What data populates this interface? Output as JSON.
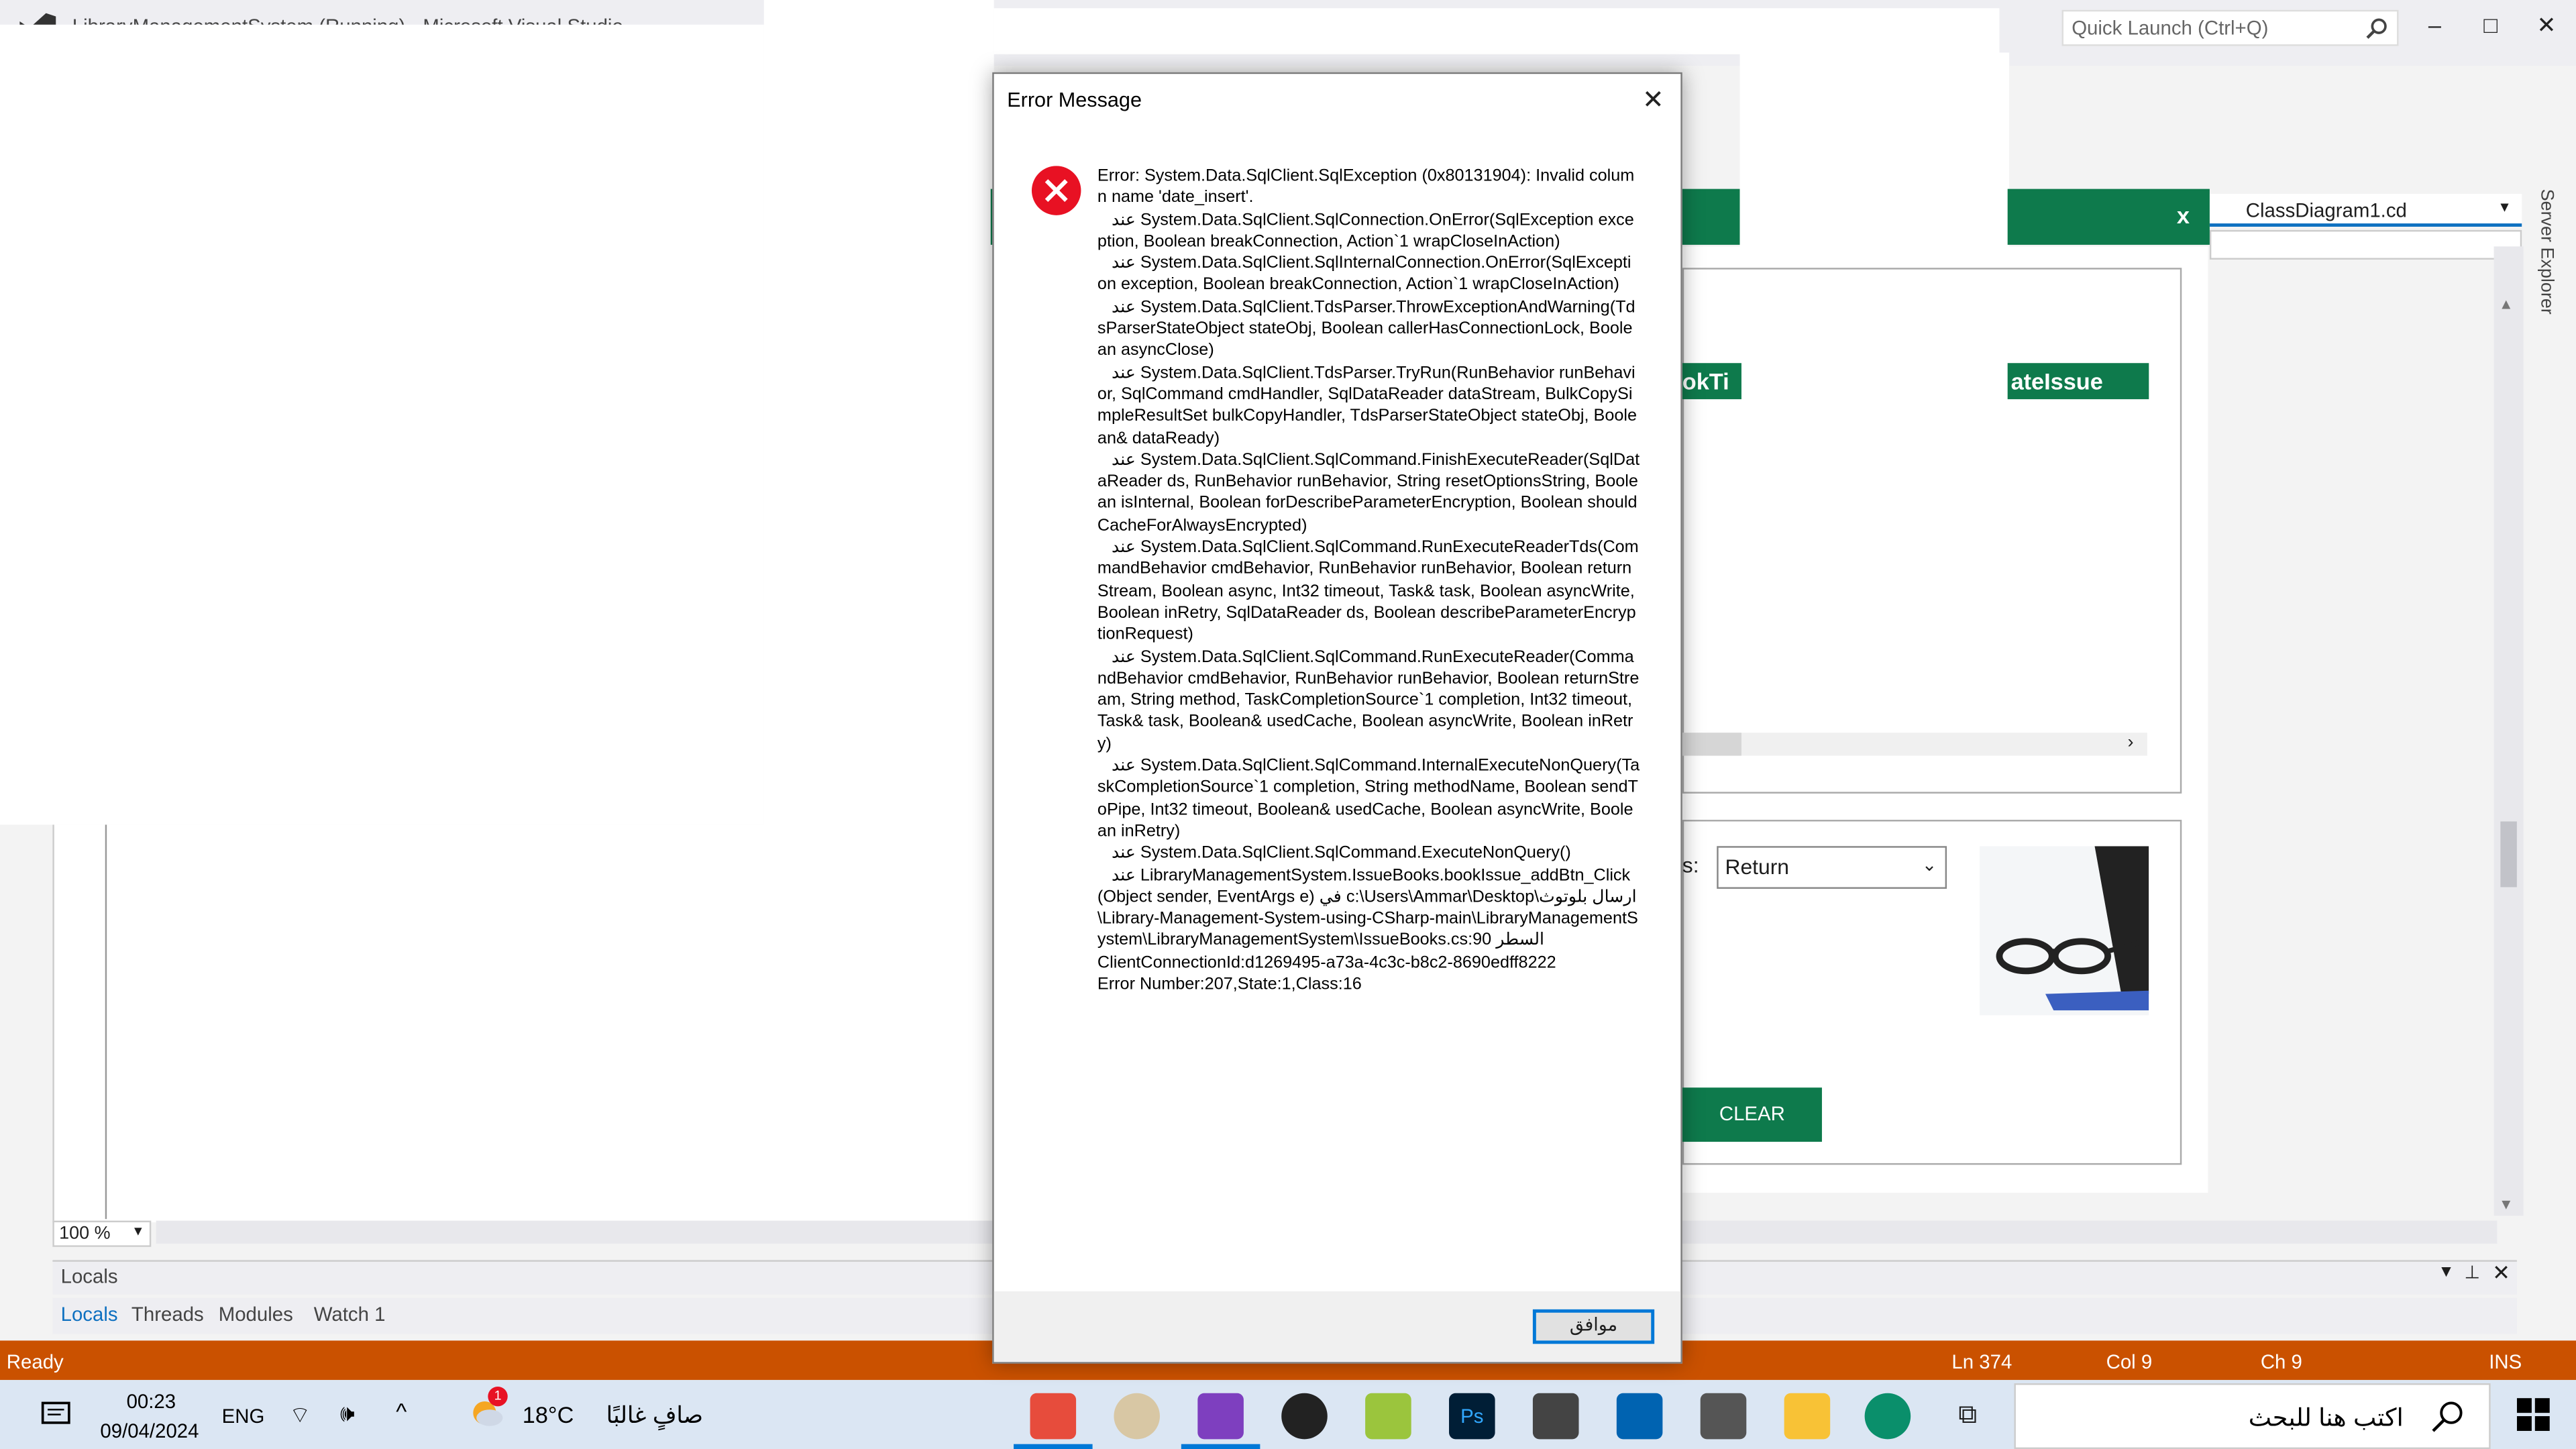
{
  "vs": {
    "title": "LibraryManagementSystem (Running) - Microsoft Visual Studio",
    "quick_launch_placeholder": "Quick Launch (Ctrl+Q)",
    "minimize": "–",
    "maximize": "□",
    "close": "✕",
    "class_diagram_tab": "ClassDiagram1.cd",
    "server_explorer": "Server Explorer",
    "zoom": "100 %",
    "locals_title": "Locals",
    "bottom_tabs": [
      "Locals",
      "Threads",
      "Modules",
      "Watch 1"
    ],
    "status": {
      "ready": "Ready",
      "ln": "Ln 374",
      "col": "Col 9",
      "ch": "Ch 9",
      "ins": "INS"
    }
  },
  "form": {
    "close_label": "x",
    "grid_header_left": "okTi",
    "grid_header_right": "ateIssue",
    "status_label": "s:",
    "status_value": "Return",
    "clear_button": "CLEAR"
  },
  "dialog": {
    "title": "Error Message",
    "message": "Error: System.Data.SqlClient.SqlException (0x80131904): Invalid column name 'date_insert'.\n   عند System.Data.SqlClient.SqlConnection.OnError(SqlException exception, Boolean breakConnection, Action`1 wrapCloseInAction)\n   عند System.Data.SqlClient.SqlInternalConnection.OnError(SqlException exception, Boolean breakConnection, Action`1 wrapCloseInAction)\n   عند System.Data.SqlClient.TdsParser.ThrowExceptionAndWarning(TdsParserStateObject stateObj, Boolean callerHasConnectionLock, Boolean asyncClose)\n   عند System.Data.SqlClient.TdsParser.TryRun(RunBehavior runBehavior, SqlCommand cmdHandler, SqlDataReader dataStream, BulkCopySimpleResultSet bulkCopyHandler, TdsParserStateObject stateObj, Boolean& dataReady)\n   عند System.Data.SqlClient.SqlCommand.FinishExecuteReader(SqlDataReader ds, RunBehavior runBehavior, String resetOptionsString, Boolean isInternal, Boolean forDescribeParameterEncryption, Boolean shouldCacheForAlwaysEncrypted)\n   عند System.Data.SqlClient.SqlCommand.RunExecuteReaderTds(CommandBehavior cmdBehavior, RunBehavior runBehavior, Boolean returnStream, Boolean async, Int32 timeout, Task& task, Boolean asyncWrite, Boolean inRetry, SqlDataReader ds, Boolean describeParameterEncryptionRequest)\n   عند System.Data.SqlClient.SqlCommand.RunExecuteReader(CommandBehavior cmdBehavior, RunBehavior runBehavior, Boolean returnStream, String method, TaskCompletionSource`1 completion, Int32 timeout, Task& task, Boolean& usedCache, Boolean asyncWrite, Boolean inRetry)\n   عند System.Data.SqlClient.SqlCommand.InternalExecuteNonQuery(TaskCompletionSource`1 completion, String methodName, Boolean sendToPipe, Int32 timeout, Boolean& usedCache, Boolean asyncWrite, Boolean inRetry)\n   عند System.Data.SqlClient.SqlCommand.ExecuteNonQuery()\n   عند LibraryManagementSystem.IssueBooks.bookIssue_addBtn_Click(Object sender, EventArgs e) في c:\\Users\\Ammar\\Desktop\\ارسال بلوتوث\\Library-Management-System-using-CSharp-main\\LibraryManagementSystem\\LibraryManagementSystem\\IssueBooks.cs:السطر 90\nClientConnectionId:d1269495-a73a-4c3c-b8c2-8690edff8222\nError Number:207,State:1,Class:16",
    "ok_button": "موافق"
  },
  "taskbar": {
    "time": "00:23",
    "date": "09/04/2024",
    "lang": "ENG",
    "weather_temp": "18°C",
    "weather_desc": "صافٍ غالبًا",
    "notif_badge": "1",
    "search_placeholder": "اكتب هنا للبحث",
    "colors": {
      "status_bar": "#ca5100",
      "form_green": "#0e7a4c",
      "accent_blue": "#0078d7"
    }
  }
}
